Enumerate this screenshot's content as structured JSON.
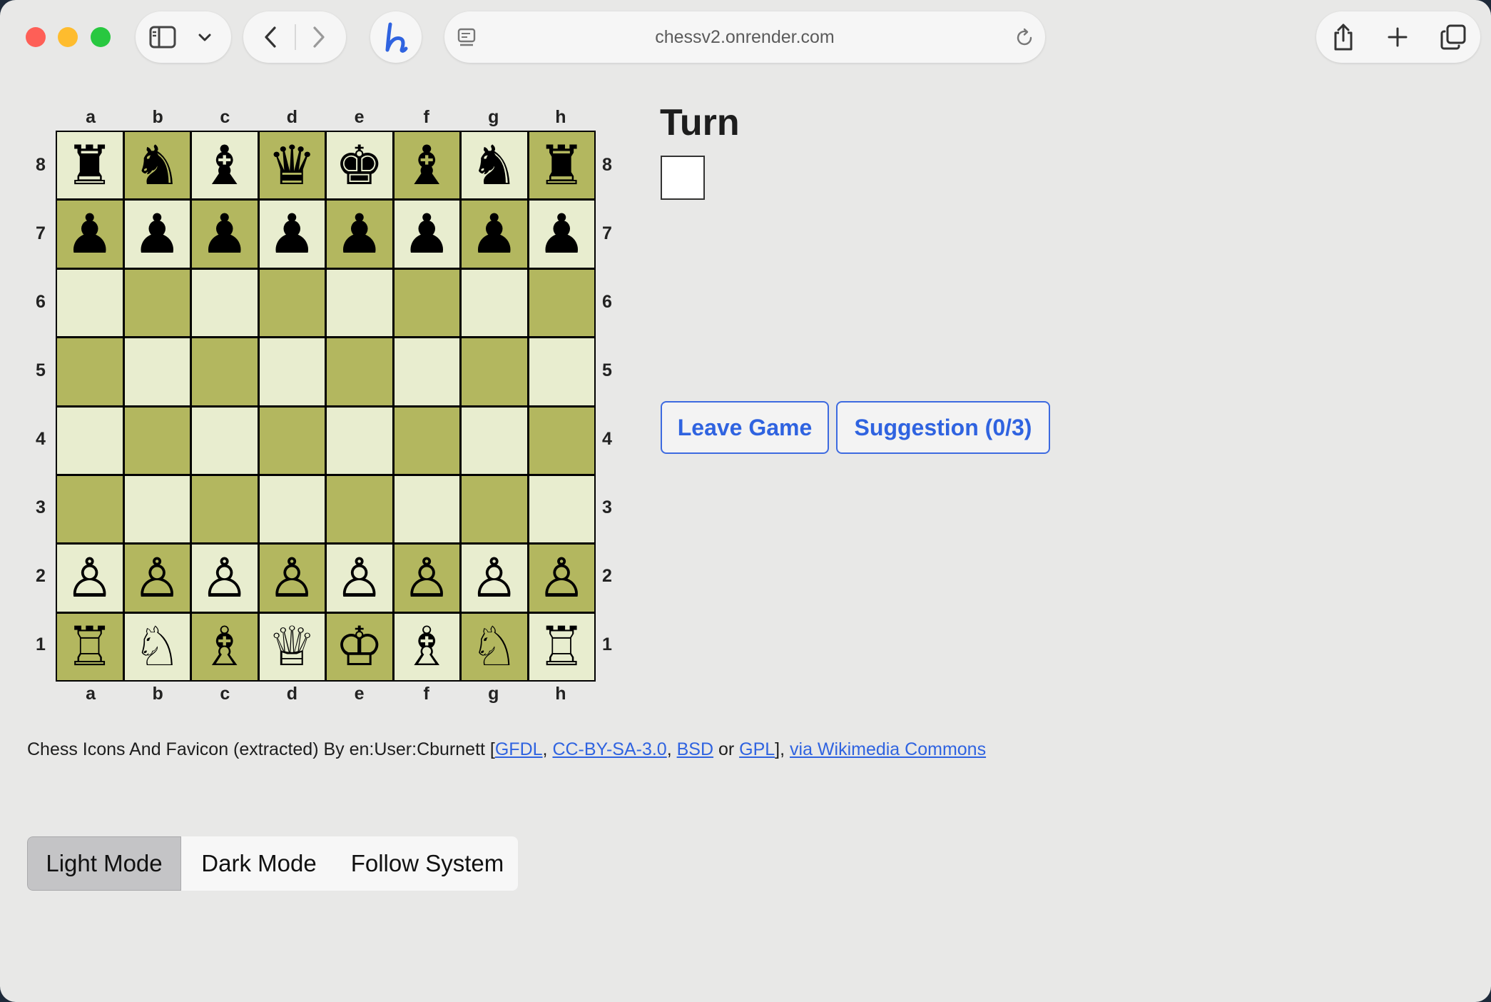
{
  "browser": {
    "url": "chessv2.onrender.com",
    "traffic_lights": {
      "close": "#fe5f57",
      "minimize": "#febc2e",
      "zoom": "#28c840"
    },
    "icons": [
      "sidebar-icon",
      "chevron-down-icon",
      "back-arrow-icon",
      "forward-arrow-icon",
      "honey-extension-icon",
      "page-menu-icon",
      "reload-icon",
      "share-icon",
      "new-tab-icon",
      "tab-overview-icon"
    ]
  },
  "board": {
    "files": [
      "a",
      "b",
      "c",
      "d",
      "e",
      "f",
      "g",
      "h"
    ],
    "ranks": [
      "8",
      "7",
      "6",
      "5",
      "4",
      "3",
      "2",
      "1"
    ],
    "rows": [
      [
        "♜",
        "♞",
        "♝",
        "♛",
        "♚",
        "♝",
        "♞",
        "♜"
      ],
      [
        "♟",
        "♟",
        "♟",
        "♟",
        "♟",
        "♟",
        "♟",
        "♟"
      ],
      [
        "",
        "",
        "",
        "",
        "",
        "",
        "",
        ""
      ],
      [
        "",
        "",
        "",
        "",
        "",
        "",
        "",
        ""
      ],
      [
        "",
        "",
        "",
        "",
        "",
        "",
        "",
        ""
      ],
      [
        "",
        "",
        "",
        "",
        "",
        "",
        "",
        ""
      ],
      [
        "♙",
        "♙",
        "♙",
        "♙",
        "♙",
        "♙",
        "♙",
        "♙"
      ],
      [
        "♖",
        "♘",
        "♗",
        "♕",
        "♔",
        "♗",
        "♘",
        "♖"
      ]
    ],
    "light_square_color": "#e8edcf",
    "dark_square_color": "#b3b75f"
  },
  "turn": {
    "title": "Turn",
    "indicator_color": "white"
  },
  "actions": {
    "leave": "Leave Game",
    "suggestion": "Suggestion (0/3)"
  },
  "credits": {
    "prefix": "Chess Icons And Favicon (extracted) By en:User:Cburnett [",
    "gfdl": "GFDL",
    "sep1": ", ",
    "ccbysa": "CC-BY-SA-3.0",
    "sep2": ", ",
    "bsd": "BSD",
    "or": " or ",
    "gpl": "GPL",
    "close": "], ",
    "commons": "via Wikimedia Commons"
  },
  "modes": {
    "light": "Light Mode",
    "dark": "Dark Mode",
    "system": "Follow System",
    "selected": "Light Mode"
  }
}
